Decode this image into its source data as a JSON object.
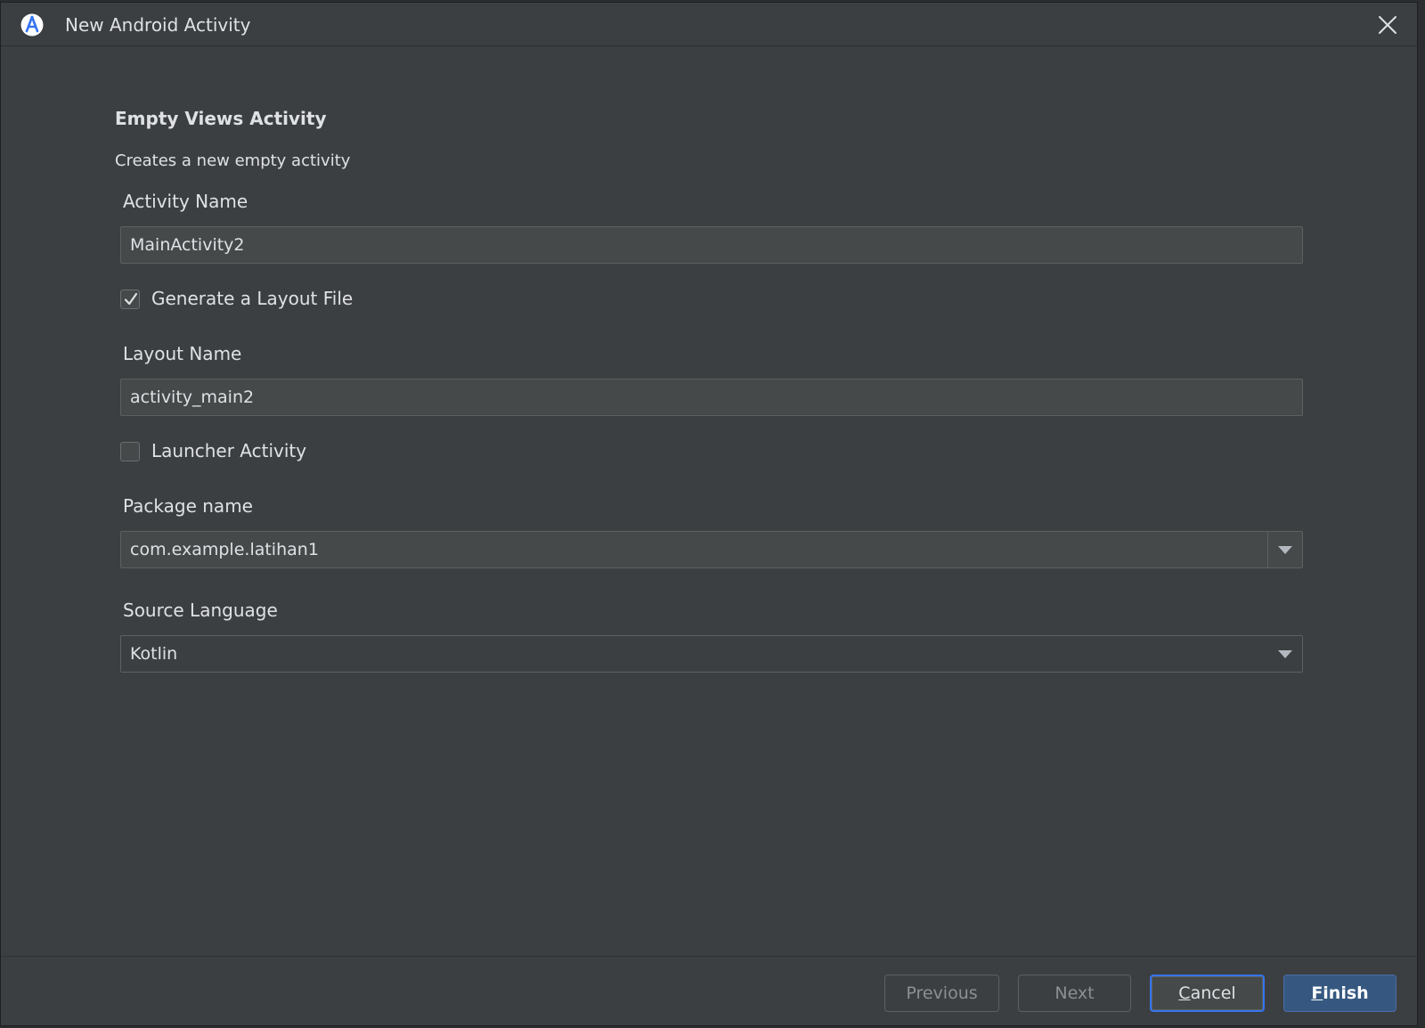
{
  "window": {
    "title": "New Android Activity",
    "app_icon": "android-studio-icon",
    "close_icon": "close-icon"
  },
  "template": {
    "heading": "Empty Views Activity",
    "description": "Creates a new empty activity"
  },
  "form": {
    "activity_name": {
      "label": "Activity Name",
      "value": "MainActivity2"
    },
    "generate_layout": {
      "label": "Generate a Layout File",
      "checked": true
    },
    "layout_name": {
      "label": "Layout Name",
      "value": "activity_main2"
    },
    "launcher_activity": {
      "label": "Launcher Activity",
      "checked": false
    },
    "package_name": {
      "label": "Package name",
      "value": "com.example.latihan1"
    },
    "source_language": {
      "label": "Source Language",
      "value": "Kotlin"
    }
  },
  "buttons": {
    "previous": "Previous",
    "next": "Next",
    "cancel": "Cancel",
    "finish": "Finish"
  },
  "colors": {
    "background": "#3c3f41",
    "accent": "#3574f0",
    "primary_button": "#365880"
  }
}
